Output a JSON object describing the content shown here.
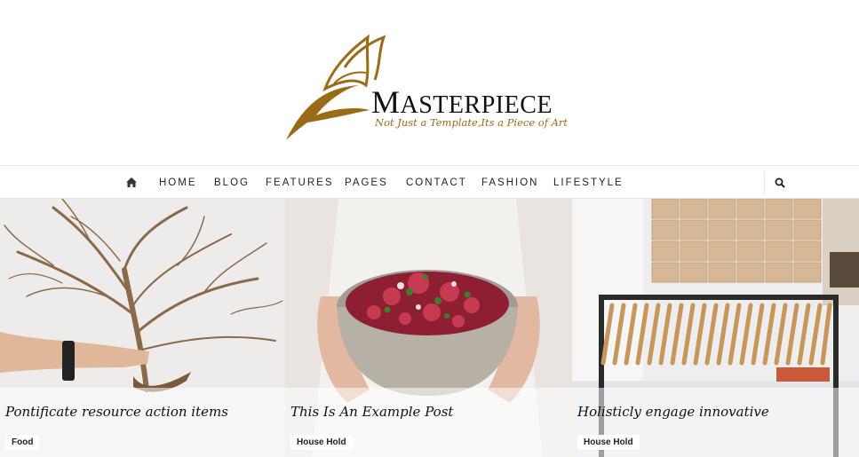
{
  "header": {
    "logo_initial": "M",
    "logo_rest": "ASTERPIECE",
    "tagline": "Not Just a Template,Its a Piece of Art"
  },
  "nav": {
    "home_icon": "home-icon",
    "items": [
      "HOME",
      "BLOG",
      "FEATURES",
      "PAGES",
      "CONTACT",
      "FASHION",
      "LIFESTYLE"
    ],
    "search_icon": "search-icon"
  },
  "posts": [
    {
      "title": "Pontificate resource action items",
      "tag": "Food"
    },
    {
      "title": "This Is An Example Post",
      "tag": "House Hold"
    },
    {
      "title": "Holisticly engage innovative",
      "tag": "House Hold"
    }
  ],
  "colors": {
    "brand_gold": "#9a6b16",
    "text_dark": "#222222"
  }
}
